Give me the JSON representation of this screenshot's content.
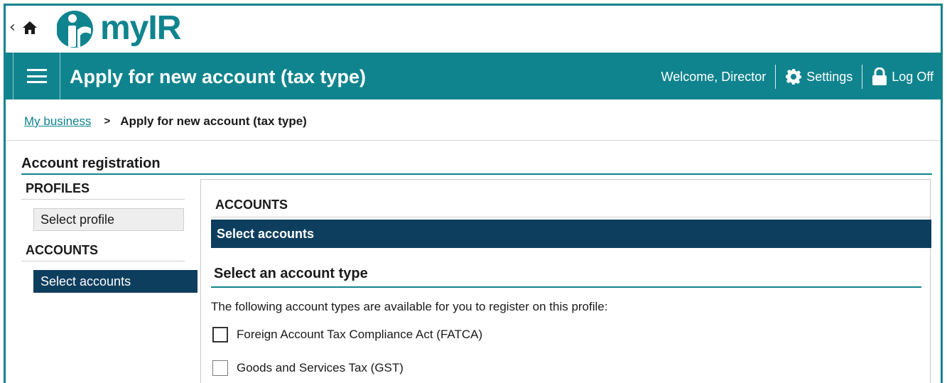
{
  "logo": {
    "brand_text": "myIR",
    "brand_color": "#10848e"
  },
  "header": {
    "title": "Apply for new account (tax type)",
    "welcome": "Welcome, Director",
    "settings_label": "Settings",
    "logoff_label": "Log Off",
    "bar_color": "#10848e"
  },
  "breadcrumb": {
    "parent": "My business",
    "separator": ">",
    "current": "Apply for new account (tax type)"
  },
  "registration": {
    "heading": "Account registration"
  },
  "left_nav": {
    "profiles_title": "PROFILES",
    "profile_item": "Select profile",
    "accounts_title": "ACCOUNTS",
    "accounts_item": "Select accounts"
  },
  "main": {
    "accounts_title": "ACCOUNTS",
    "section_bar": "Select accounts",
    "subheading": "Select an account type",
    "intro": "The following account types are available for you to register on this profile:",
    "options": [
      {
        "label": "Foreign Account Tax Compliance Act (FATCA)",
        "checked": false
      },
      {
        "label": "Goods and Services Tax (GST)",
        "checked": false
      }
    ],
    "selected_color": "#0e3e5e"
  },
  "icons": [
    "chevron-left-icon",
    "home-icon",
    "brand-logo-icon",
    "hamburger-menu-icon",
    "gear-icon",
    "lock-icon"
  ]
}
